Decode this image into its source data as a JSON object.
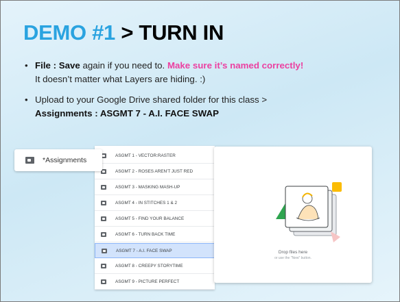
{
  "title": {
    "accent": "DEMO #1",
    "rest": " > TURN IN"
  },
  "bullets": {
    "b1": {
      "bold": "File : Save",
      "text1": " again if you need to. ",
      "pink": "Make sure it’s named correctly!",
      "line2": "It doesn’t matter what Layers are hiding.  :)"
    },
    "b2": {
      "text": "Upload to your Google Drive shared folder for this class >",
      "bold": "Assignments : ASGMT 7 - A.I. FACE SWAP"
    }
  },
  "drive": {
    "chip_label": "*Assignments",
    "icon": "shared-folder-icon",
    "folders": [
      "ASGMT 1 - VECTOR:RASTER",
      "ASGMT 2 - ROSES AREN'T JUST RED",
      "ASGMT 3 - MASKING MASH-UP",
      "ASGMT 4 - IN STITCHES 1 & 2",
      "ASGMT 5 - FIND YOUR BALANCE",
      "ASGMT 6 - TURN BACK TIME",
      "ASGMT 7 - A.I. FACE SWAP",
      "ASGMT 8 - CREEPY STORYTIME",
      "ASGMT 9 - PICTURE PERFECT"
    ],
    "selected_folder": "ASGMT 7 - A.I. FACE SWAP",
    "selected_color": "#d2e3fc"
  },
  "drop": {
    "title": "Drop files here",
    "subtitle": "or use the \"New\" button."
  },
  "colors": {
    "accent": "#2aa3e0",
    "pink": "#ec3fa0"
  }
}
